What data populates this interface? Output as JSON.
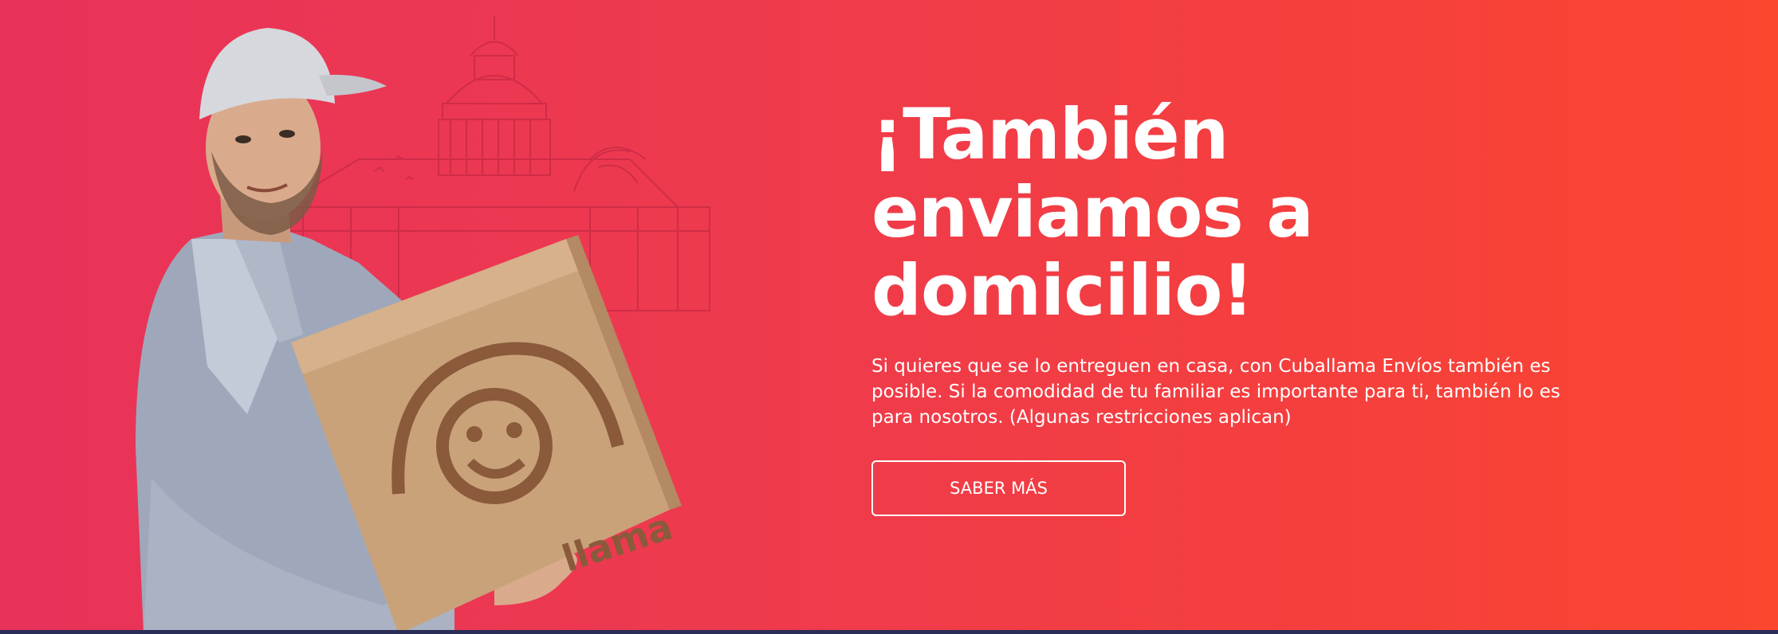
{
  "hero": {
    "headline_lines": [
      "¡También",
      "enviamos a",
      "domicilio!"
    ],
    "description": "Si quieres que se lo entreguen en casa, con Cuballama Envíos también es posible. Si la comodidad de tu familiar es importante para ti, también lo es para nosotros. (Algunas restricciones aplican)",
    "cta_label": "SABER MÁS"
  },
  "box": {
    "logo_text": "llama"
  },
  "colors": {
    "gradient_start": "#e8325a",
    "gradient_end": "#fb4630",
    "text": "#ffffff",
    "bottom_bar": "#2a2d57",
    "box": "#c9a27a",
    "box_logo": "#8a5a3b"
  },
  "icons": [
    "capitol-building-illustration",
    "smiley-logo-icon",
    "delivery-man-photo"
  ]
}
